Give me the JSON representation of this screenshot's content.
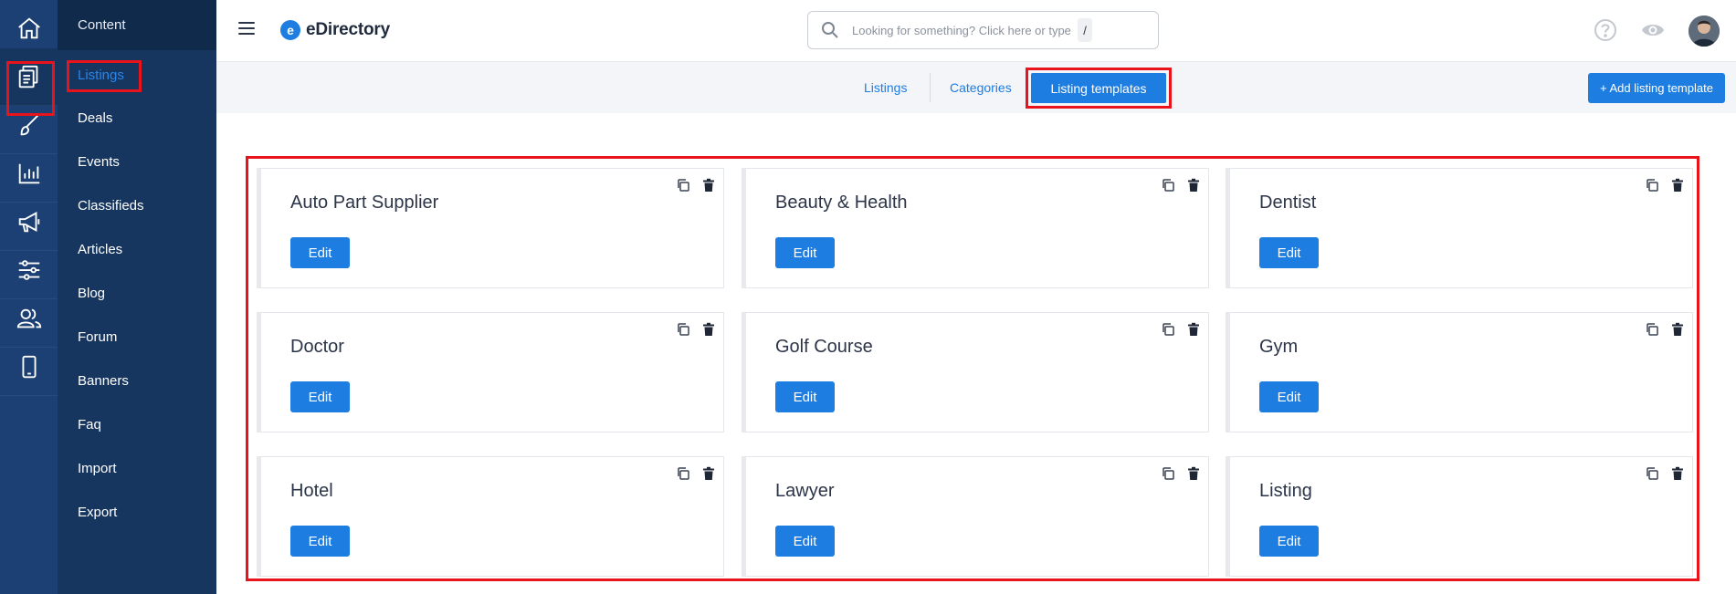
{
  "rail": {
    "items": [
      "home-icon",
      "content-icon",
      "brush-icon",
      "chart-icon",
      "megaphone-icon",
      "sliders-icon",
      "users-icon",
      "mobile-icon"
    ]
  },
  "menu": {
    "header": "Content",
    "items": [
      "Listings",
      "Deals",
      "Events",
      "Classifieds",
      "Articles",
      "Blog",
      "Forum",
      "Banners",
      "Faq",
      "Import",
      "Export"
    ],
    "active_index": 0
  },
  "topbar": {
    "logo_mark": "e",
    "logo_text": "eDirectory",
    "search_placeholder": "Looking for something? Click here or type",
    "search_shortcut": "/"
  },
  "tabs": {
    "items": [
      "Listings",
      "Categories",
      "Listing templates"
    ],
    "active": "Listing templates",
    "add_button": "+ Add listing template"
  },
  "templates": {
    "edit_label": "Edit",
    "items": [
      "Auto Part Supplier",
      "Beauty & Health",
      "Dentist",
      "Doctor",
      "Golf Course",
      "Gym",
      "Hotel",
      "Lawyer",
      "Listing"
    ]
  },
  "colors": {
    "accent": "#1e7de0",
    "rail_bg": "#1c4073",
    "menu_bg": "#16365f",
    "highlight": "#e8131b"
  }
}
